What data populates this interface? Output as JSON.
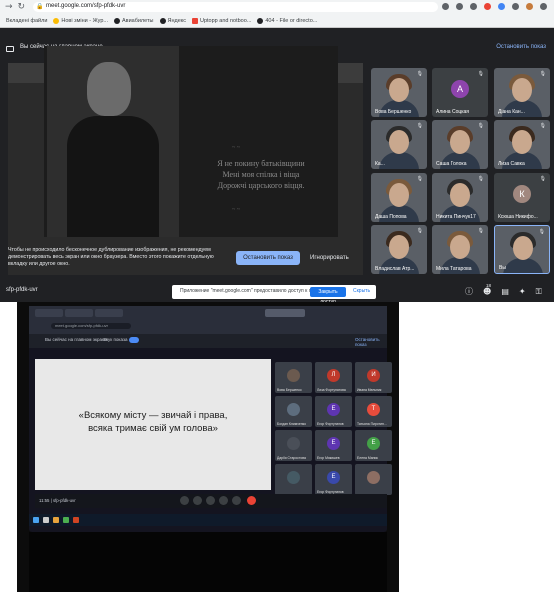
{
  "top_screenshot": {
    "url": "meet.google.com/sfp-pfdk-uvr",
    "bookmarks": [
      "Вкладені файли",
      "Нові зміни - Жур...",
      "Авиабилеты",
      "Яндекс",
      "Uptopp and notboo...",
      "404 - File or directo..."
    ],
    "banner": {
      "text": "Вы сейчас на главном экране",
      "stop_label": "Остановить показ"
    },
    "verse": {
      "line1": "Я не покину батьківщини",
      "line2": "Мені моя спілка і віща",
      "line3": "Дорожчі царського віцця."
    },
    "warning": {
      "text": "Чтобы не происходило бесконечное дублирование изображения, не рекомендуем демонстрировать весь экран или окно браузера. Вместо этого покажите отдельную вкладку или другое окно.",
      "stop_button": "Остановить показ",
      "ignore_link": "Игнорировать"
    },
    "participants": [
      {
        "name": "Вова Бершенко",
        "kind": "video"
      },
      {
        "name": "Алина Соцкая",
        "kind": "letter",
        "letter": "А",
        "color": "#8e44ad"
      },
      {
        "name": "Діана Кан...",
        "kind": "video"
      },
      {
        "name": "Ка...",
        "kind": "video"
      },
      {
        "name": "Саша Голока",
        "kind": "video"
      },
      {
        "name": "Лиза Савка",
        "kind": "video"
      },
      {
        "name": "Даша Попова",
        "kind": "video"
      },
      {
        "name": "Никита Пинчук17",
        "kind": "video"
      },
      {
        "name": "Ксюша Никифо...",
        "kind": "letter",
        "letter": "К",
        "color": "#a1887f"
      },
      {
        "name": "Владислав Атр...",
        "kind": "video"
      },
      {
        "name": "Мила Татарова",
        "kind": "video"
      },
      {
        "name": "Вы",
        "kind": "video"
      }
    ],
    "meeting_code": "sfp-pfdk-uvr",
    "participant_count": "18",
    "share_bar": {
      "text": "Приложение \"meet.google.com\" предоставило доступ к окну.",
      "close_label": "Закрыть доступ",
      "hide_label": "Скрыть"
    },
    "icons": [
      "info-icon",
      "people-icon",
      "chat-icon",
      "activities-icon",
      "lock-icon"
    ]
  },
  "bottom_photo": {
    "url": "meet.google.com/sfp-pfdk-uvr",
    "banner_text": "Вы сейчас на главном экране",
    "sound_label": "Звук показа",
    "stop_label": "Остановить показ",
    "quote": {
      "line1": "«Всякому місту — звичай і права,",
      "line2": "всяка тримає свій ум голова»"
    },
    "meeting_time": "11:55",
    "meeting_code": "sfp-pfdk-uvr",
    "participants": [
      {
        "name": "Вова Бершенко",
        "letter": "",
        "color": "#6b5a4f"
      },
      {
        "name": "Лиза Фортунатова",
        "letter": "Л",
        "color": "#c0392b"
      },
      {
        "name": "Ивана Мельник",
        "letter": "И",
        "color": "#c0392b"
      },
      {
        "name": "Богдан Климченко",
        "letter": "",
        "color": "#5d6d7e"
      },
      {
        "name": "Егор Фортунатов",
        "letter": "Е",
        "color": "#5e35b1"
      },
      {
        "name": "Татьяна Пиротин...",
        "letter": "Т",
        "color": "#e74c3c"
      },
      {
        "name": "Даріїя Старостова",
        "letter": "",
        "color": "#4a4f58"
      },
      {
        "name": "Егор Мякишев",
        "letter": "Е",
        "color": "#5e35b1"
      },
      {
        "name": "Елена Маник",
        "letter": "Е",
        "color": "#43a047"
      },
      {
        "name": "",
        "letter": "",
        "color": "#455a64"
      },
      {
        "name": "Егор Фортунатов",
        "letter": "Е",
        "color": "#3949ab"
      },
      {
        "name": "",
        "letter": "",
        "color": "#8d6e63"
      }
    ]
  }
}
